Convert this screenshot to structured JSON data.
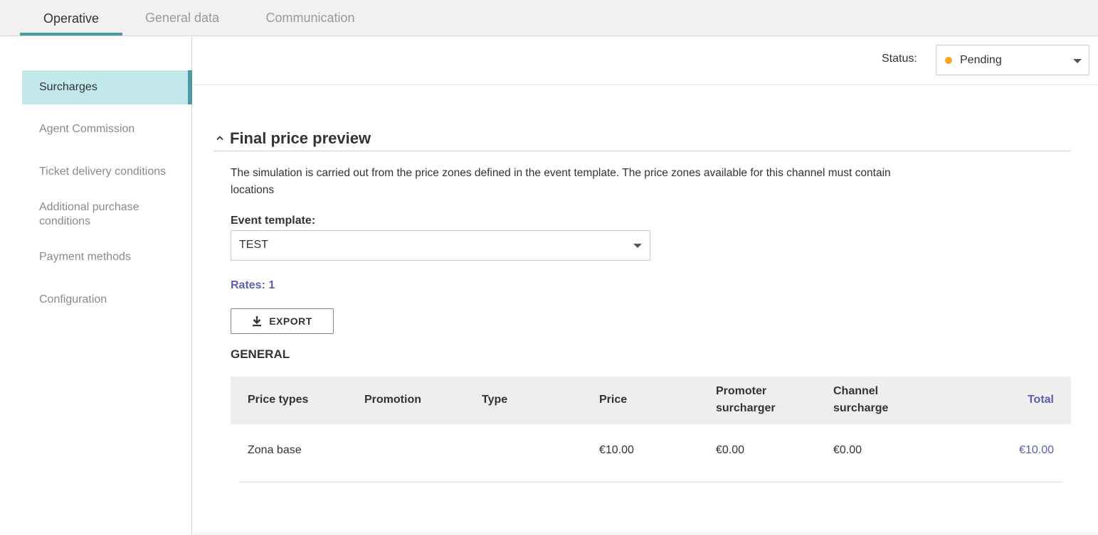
{
  "tabs": [
    {
      "label": "Operative",
      "active": true
    },
    {
      "label": "General data",
      "active": false
    },
    {
      "label": "Communication",
      "active": false
    }
  ],
  "sidebar": {
    "items": [
      {
        "label": "Surcharges",
        "active": true
      },
      {
        "label": "Agent Commission",
        "active": false
      },
      {
        "label": "Ticket delivery conditions",
        "active": false
      },
      {
        "label": "Additional purchase conditions",
        "active": false
      },
      {
        "label": "Payment methods",
        "active": false
      },
      {
        "label": "Configuration",
        "active": false
      }
    ]
  },
  "status": {
    "label": "Status:",
    "value": "Pending",
    "dot_color": "#f5a81c"
  },
  "section": {
    "title": "Final price preview",
    "description": "The simulation is carried out from the price zones defined in the event template. The price zones available for this channel must contain locations",
    "event_template_label": "Event template:",
    "event_template_value": "TEST",
    "rates": "Rates: 1",
    "export_label": "EXPORT",
    "group_title": "GENERAL"
  },
  "table": {
    "headers": {
      "price_types": "Price types",
      "promotion": "Promotion",
      "type": "Type",
      "price": "Price",
      "promoter_surcharge": "Promoter surcharger",
      "channel_surcharge": "Channel surcharge",
      "total": "Total"
    },
    "rows": [
      {
        "price_type": "Zona base",
        "promotion": "",
        "type": "",
        "price": "€10.00",
        "promoter_surcharge": "€0.00",
        "channel_surcharge": "€0.00",
        "total": "€10.00"
      }
    ]
  },
  "colors": {
    "accent": "#4a9ba2",
    "active_bg": "#c3e8ec",
    "link": "#5b5fb0",
    "pending": "#f5a81c"
  }
}
